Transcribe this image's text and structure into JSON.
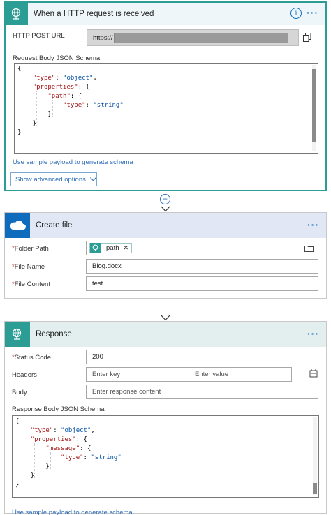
{
  "trigger": {
    "title": "When a HTTP request is received",
    "url_label": "HTTP POST URL",
    "url_value": "https://",
    "schema_label": "Request Body JSON Schema",
    "schema_lines": [
      "{",
      "    \"type\": \"object\",",
      "    \"properties\": {",
      "        \"path\": {",
      "            \"type\": \"string\"",
      "        }",
      "    }",
      "}"
    ],
    "sample_link": "Use sample payload to generate schema",
    "advanced_label": "Show advanced options"
  },
  "create_file": {
    "title": "Create file",
    "folder_label": "Folder Path",
    "folder_token": "path",
    "name_label": "File Name",
    "name_value": "Blog.docx",
    "content_label": "File Content",
    "content_value": "test"
  },
  "response": {
    "title": "Response",
    "status_label": "Status Code",
    "status_value": "200",
    "headers_label": "Headers",
    "key_placeholder": "Enter key",
    "value_placeholder": "Enter value",
    "body_label": "Body",
    "body_placeholder": "Enter response content",
    "schema_label": "Response Body JSON Schema",
    "schema_lines": [
      "{",
      "    \"type\": \"object\",",
      "    \"properties\": {",
      "        \"message\": {",
      "            \"type\": \"string\"",
      "        }",
      "    }",
      "}"
    ],
    "sample_link": "Use sample payload to generate schema"
  },
  "colors": {
    "teal": "#2b9d94",
    "onedrive_blue": "#0f6cbd",
    "header_bg": "#e8f4fb",
    "link": "#2f6fba"
  },
  "icons": [
    "globe-icon",
    "info-icon",
    "copy-icon",
    "onedrive-cloud-icon",
    "folder-icon",
    "remove-token-icon",
    "chevron-down-icon",
    "add-step-icon",
    "arrow-down-icon",
    "switch-mode-icon"
  ]
}
